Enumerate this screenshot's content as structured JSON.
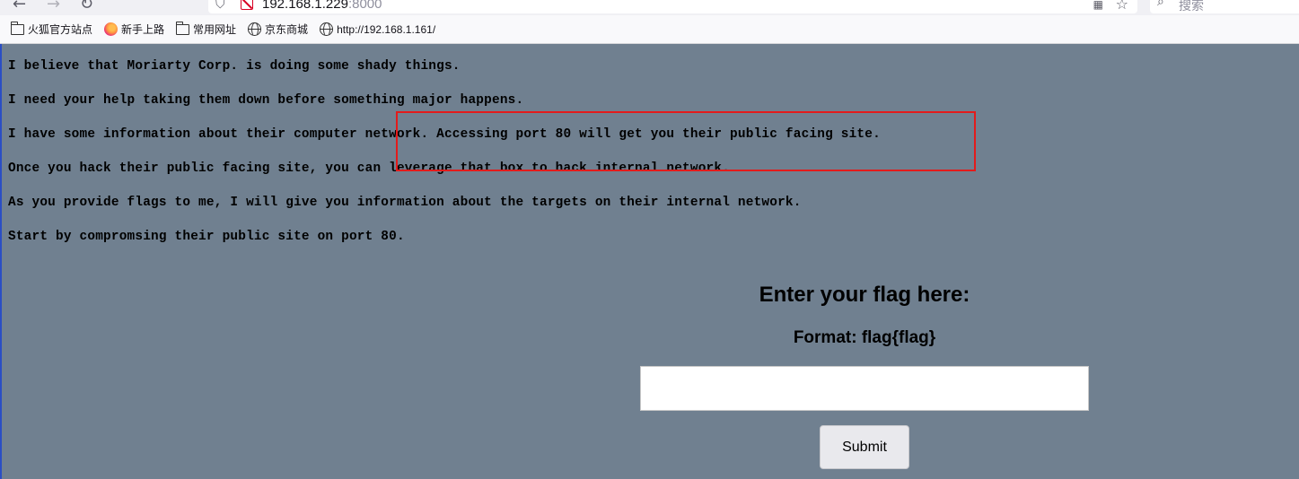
{
  "browser": {
    "url_host": "192.168.1.229",
    "url_port": ":8000",
    "search_placeholder": "搜索",
    "bookmarks": [
      {
        "label": "火狐官方站点",
        "icon": "folder-icon"
      },
      {
        "label": "新手上路",
        "icon": "firefox-icon"
      },
      {
        "label": "常用网址",
        "icon": "folder-icon"
      },
      {
        "label": "京东商城",
        "icon": "globe-icon"
      },
      {
        "label": "http://192.168.1.161/",
        "icon": "globe-icon"
      }
    ]
  },
  "page": {
    "lines": [
      "I believe that Moriarty Corp. is doing some shady things.",
      "I need your help taking them down before something major happens.",
      "I have some information about their computer network. Accessing port 80 will get you their public facing site.",
      "Once you hack their public facing site, you can leverage that box to hack internal network.",
      "As you provide flags to me, I will give you information about the targets on their internal network.",
      "Start by compromsing their public site on port 80."
    ],
    "flag_heading": "Enter your flag here:",
    "format_label": "Format: flag{flag}",
    "flag_input_value": "",
    "submit_label": "Submit"
  },
  "colors": {
    "page_background": "#708090",
    "highlight_box": "#e31b1b"
  }
}
